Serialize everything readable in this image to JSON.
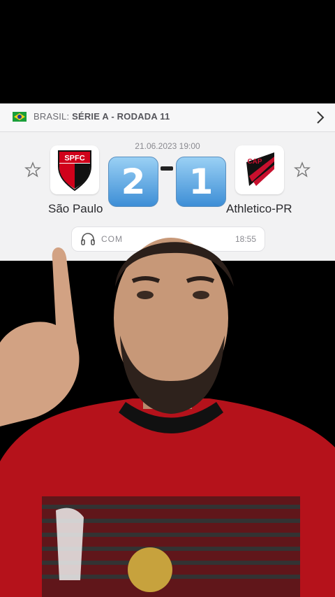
{
  "league": {
    "country": "BRASIL:",
    "competition": "SÉRIE A - RODADA 11"
  },
  "match": {
    "datetime": "21.06.2023 19:00",
    "home": {
      "name": "São Paulo",
      "logo_text": "SPFC",
      "score": "2"
    },
    "away": {
      "name": "Athletico-PR",
      "logo_text": "CAP",
      "score": "1"
    },
    "score_separator": "-"
  },
  "commentary": {
    "label": "COM",
    "time": "18:55"
  },
  "icons": {
    "flag": "brazil-flag-icon",
    "chevron": "chevron-right-icon",
    "favorite": "star-outline-icon",
    "commentary": "headphones-icon"
  },
  "colors": {
    "score_blue": "#4a9be0",
    "card_bg": "#f2f2f3",
    "home_red": "#d0021b",
    "away_red": "#c8102e"
  }
}
